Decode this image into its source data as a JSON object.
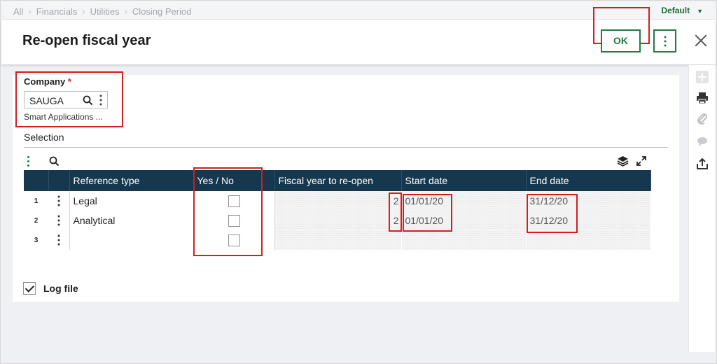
{
  "breadcrumb": [
    "All",
    "Financials",
    "Utilities",
    "Closing Period"
  ],
  "profile": {
    "label": "Default"
  },
  "page": {
    "title": "Re-open fiscal year"
  },
  "actions": {
    "ok_label": "OK"
  },
  "company": {
    "label": "Company",
    "required_mark": "*",
    "value": "SAUGA",
    "description": "Smart Applications ..."
  },
  "selection": {
    "title": "Selection",
    "columns": [
      "Reference type",
      "Yes / No",
      "Fiscal year to re-open",
      "Start date",
      "End date"
    ],
    "rows": [
      {
        "num": "1",
        "reference_type": "Legal",
        "fiscal_year": "2",
        "start_date": "01/01/20",
        "end_date": "31/12/20"
      },
      {
        "num": "2",
        "reference_type": "Analytical",
        "fiscal_year": "2",
        "start_date": "01/01/20",
        "end_date": "31/12/20"
      },
      {
        "num": "3",
        "reference_type": "",
        "fiscal_year": "",
        "start_date": "",
        "end_date": ""
      }
    ]
  },
  "log_file": {
    "label": "Log file",
    "checked": true
  },
  "colors": {
    "accent_green": "#1f7a45",
    "grid_header": "#15384f",
    "highlight_red": "#d21f1f"
  },
  "icons": [
    "chevron-right-icon",
    "caret-down-icon",
    "more-vertical-icon",
    "close-icon",
    "add-icon",
    "print-icon",
    "attachment-icon",
    "comment-icon",
    "share-icon",
    "search-icon",
    "layers-icon",
    "expand-icon",
    "checkbox-checked-icon"
  ]
}
